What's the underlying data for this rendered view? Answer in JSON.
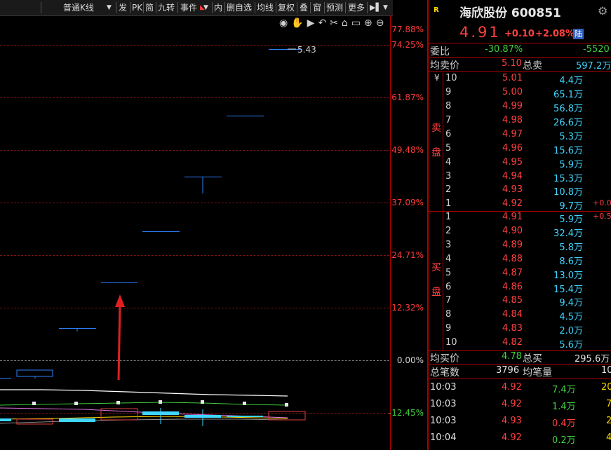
{
  "toolbar": {
    "kline_mode": "普通K线",
    "items": [
      "发",
      "PK",
      "简",
      "九转",
      "事件",
      "内",
      "删自选",
      "均线",
      "复权",
      "叠",
      "窗",
      "预测",
      "更多"
    ]
  },
  "chart": {
    "y_labels": [
      "77.88%",
      "74.25%",
      "61.87%",
      "49.48%",
      "37.09%",
      "24.71%",
      "12.32%",
      "0.00%",
      "-12.45%"
    ],
    "annotation": "5.43"
  },
  "quote": {
    "badge": "R",
    "name_code": "海欣股份 600851",
    "price": "4.91",
    "change": "+0.10",
    "pct": "+2.08%",
    "tag": "陆",
    "weibi_label": "委比",
    "weibi_pct": "-30.87%",
    "weibi_diff": "-5520",
    "sell_avg_label": "均卖价",
    "sell_avg": "5.10",
    "sell_total_label": "总卖",
    "sell_total": "597.2万",
    "yen": "¥",
    "sell_label_1": "卖",
    "sell_label_2": "盘",
    "buy_label_1": "买",
    "buy_label_2": "盘",
    "sell": [
      {
        "lv": "10",
        "p": "5.01",
        "v": "4.4万",
        "c": ""
      },
      {
        "lv": "9",
        "p": "5.00",
        "v": "65.1万",
        "c": ""
      },
      {
        "lv": "8",
        "p": "4.99",
        "v": "56.8万",
        "c": ""
      },
      {
        "lv": "7",
        "p": "4.98",
        "v": "26.6万",
        "c": ""
      },
      {
        "lv": "6",
        "p": "4.97",
        "v": "5.3万",
        "c": ""
      },
      {
        "lv": "5",
        "p": "4.96",
        "v": "15.6万",
        "c": ""
      },
      {
        "lv": "4",
        "p": "4.95",
        "v": "5.9万",
        "c": ""
      },
      {
        "lv": "3",
        "p": "4.94",
        "v": "15.3万",
        "c": ""
      },
      {
        "lv": "2",
        "p": "4.93",
        "v": "10.8万",
        "c": ""
      },
      {
        "lv": "1",
        "p": "4.92",
        "v": "9.7万",
        "c": "+0.0"
      }
    ],
    "buy": [
      {
        "lv": "1",
        "p": "4.91",
        "v": "5.9万",
        "c": "+0.5"
      },
      {
        "lv": "2",
        "p": "4.90",
        "v": "32.4万",
        "c": ""
      },
      {
        "lv": "3",
        "p": "4.89",
        "v": "5.8万",
        "c": ""
      },
      {
        "lv": "4",
        "p": "4.88",
        "v": "8.6万",
        "c": ""
      },
      {
        "lv": "5",
        "p": "4.87",
        "v": "13.0万",
        "c": ""
      },
      {
        "lv": "6",
        "p": "4.86",
        "v": "15.4万",
        "c": ""
      },
      {
        "lv": "7",
        "p": "4.85",
        "v": "9.4万",
        "c": ""
      },
      {
        "lv": "8",
        "p": "4.84",
        "v": "4.5万",
        "c": ""
      },
      {
        "lv": "9",
        "p": "4.83",
        "v": "2.0万",
        "c": ""
      },
      {
        "lv": "10",
        "p": "4.82",
        "v": "5.6万",
        "c": ""
      }
    ],
    "buy_avg_label": "均买价",
    "buy_avg": "4.78",
    "buy_total_label": "总买",
    "buy_total": "295.6万",
    "ticks_label": "总笔数",
    "ticks": "3796",
    "avg_vol_label": "均笔量",
    "avg_vol": "10",
    "trades": [
      {
        "t": "10:03",
        "p": "4.92",
        "v": "7.4万",
        "n": "20"
      },
      {
        "t": "10:03",
        "p": "4.92",
        "v": "1.4万",
        "n": "7"
      },
      {
        "t": "10:03",
        "p": "4.93",
        "v": "0.4万",
        "n": "2"
      },
      {
        "t": "10:04",
        "p": "4.92",
        "v": "0.2万",
        "n": "4"
      }
    ]
  }
}
